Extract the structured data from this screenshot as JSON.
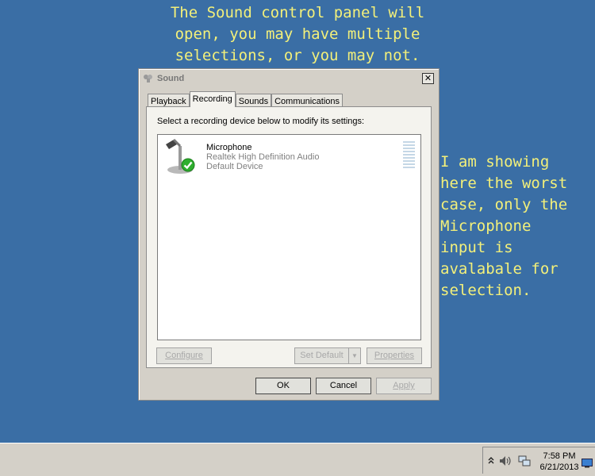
{
  "annotations": {
    "top": "The Sound control panel will\nopen, you may have multiple\nselections, or you may not.",
    "right": "I am showing\nhere the worst\ncase, only the\nMicrophone\ninput is\navalabale for\nselection."
  },
  "dialog": {
    "title": "Sound",
    "close_label": "✕",
    "tabs": [
      {
        "label": "Playback"
      },
      {
        "label": "Recording"
      },
      {
        "label": "Sounds"
      },
      {
        "label": "Communications"
      }
    ],
    "instruction": "Select a recording device below to modify its settings:",
    "device": {
      "name": "Microphone",
      "driver": "Realtek High Definition Audio",
      "status": "Default Device",
      "icon": "microphone-icon",
      "badge_icon": "green-checkmark-icon"
    },
    "buttons": {
      "configure": "Configure",
      "set_default": "Set Default",
      "set_default_arrow": "▼",
      "properties": "Properties",
      "ok": "OK",
      "cancel": "Cancel",
      "apply": "Apply"
    }
  },
  "taskbar": {
    "time": "7:58 PM",
    "date": "6/21/2013",
    "tray_icons": [
      "chevron-up-icon",
      "speaker-icon",
      "network-icon",
      "show-desktop-icon"
    ]
  },
  "colors": {
    "desktop": "#3a6ea5",
    "annotation_text": "#f3f07a",
    "checkmark": "#2fae2f"
  }
}
